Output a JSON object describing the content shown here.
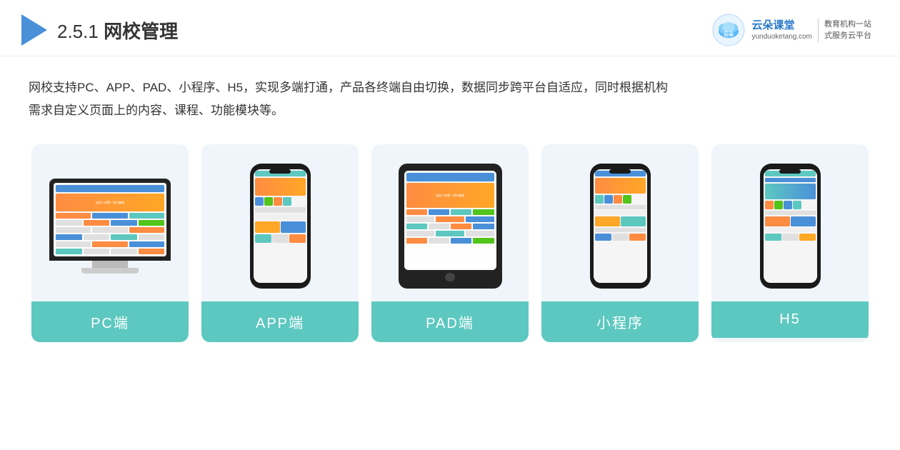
{
  "header": {
    "section_number": "2.5.1",
    "title_plain": "",
    "title_bold": "网校管理",
    "brand": {
      "name": "云朵课堂",
      "domain": "yunduoketang.com",
      "slogan_line1": "教育机构一站",
      "slogan_line2": "式服务云平台"
    }
  },
  "description": {
    "text_line1": "网校支持PC、APP、PAD、小程序、H5，实现多端打通，产品各终端自由切换，数据同步跨平台自适应，同时根据机构",
    "text_line2": "需求自定义页面上的内容、课程、功能模块等。"
  },
  "cards": [
    {
      "id": "pc",
      "label": "PC端"
    },
    {
      "id": "app",
      "label": "APP端"
    },
    {
      "id": "pad",
      "label": "PAD端"
    },
    {
      "id": "miniapp",
      "label": "小程序"
    },
    {
      "id": "h5",
      "label": "H5"
    }
  ]
}
